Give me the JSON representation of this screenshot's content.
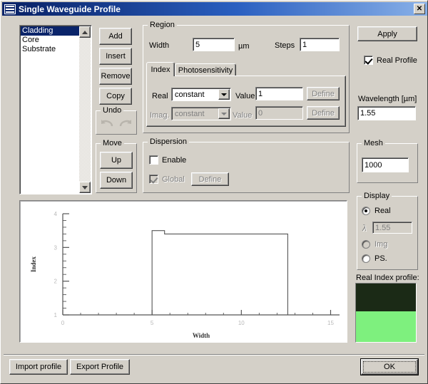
{
  "window": {
    "title": "Single Waveguide Profile",
    "close_label": "✕",
    "icon": "waveguide-icon"
  },
  "layers": {
    "items": [
      {
        "label": "Cladding",
        "selected": true
      },
      {
        "label": "Core",
        "selected": false
      },
      {
        "label": "Substrate",
        "selected": false
      }
    ]
  },
  "layer_buttons": {
    "add": "Add",
    "insert": "Insert",
    "remove": "Remove",
    "copy": "Copy"
  },
  "undo": {
    "title": "Undo",
    "undo_icon": "undo-arrow-icon",
    "redo_icon": "redo-arrow-icon"
  },
  "move": {
    "title": "Move",
    "up": "Up",
    "down": "Down"
  },
  "region": {
    "title": "Region",
    "width_label": "Width",
    "width_value": "5",
    "unit": "µm",
    "steps_label": "Steps",
    "steps_value": "1"
  },
  "tabs": [
    {
      "label": "Index",
      "active": true
    },
    {
      "label": "Photosensitivity",
      "active": false
    }
  ],
  "index_tab": {
    "real_label": "Real",
    "real_mode": "constant",
    "real_value_label": "Value",
    "real_value": "1",
    "real_define": "Define",
    "imag_label": "Imag.",
    "imag_mode": "constant",
    "imag_value_label": "Value",
    "imag_value": "0",
    "imag_define": "Define"
  },
  "dispersion": {
    "title": "Dispersion",
    "enable_label": "Enable",
    "enable_checked": false,
    "global_label": "Global",
    "global_checked": true,
    "define_label": "Define"
  },
  "right_panel": {
    "apply": "Apply",
    "real_profile_label": "Real Profile",
    "real_profile_checked": true,
    "wavelength_label": "Wavelength [µm]",
    "wavelength_value": "1.55",
    "mesh_title": "Mesh",
    "mesh_value": "1000"
  },
  "display": {
    "title": "Display",
    "real_label": "Real",
    "real_selected": true,
    "lambda_symbol": "λ",
    "lambda_value": "1.55",
    "img_label": "Img",
    "img_selected": false,
    "ps_label": "PS.",
    "ps_selected": false
  },
  "index_profile": {
    "caption": "Real Index profile:",
    "top_color": "#1b2a16",
    "bottom_color": "#7ef07e"
  },
  "footer": {
    "import": "Import profile",
    "export": "Export Profile",
    "ok": "OK"
  },
  "chart_data": {
    "type": "line",
    "title": "",
    "xlabel": "Width",
    "ylabel": "Index",
    "xlim": [
      0,
      15.5
    ],
    "ylim": [
      1,
      4
    ],
    "xticks": [
      0,
      5,
      10,
      15
    ],
    "xtick_labels": [
      "0",
      "5",
      "10",
      "15"
    ],
    "yticks": [
      1,
      2,
      3,
      4
    ],
    "ytick_labels": [
      "1",
      "2",
      "3",
      "4"
    ],
    "xminor_step": 1,
    "yminor_step": 0.2,
    "grid": false,
    "legend": null,
    "series": [
      {
        "name": "Real index profile",
        "color": "#555555",
        "x": [
          0,
          5,
          5,
          5.7,
          5.7,
          12.6,
          12.6,
          15.5
        ],
        "y": [
          1,
          1,
          3.5,
          3.5,
          3.4,
          3.4,
          1,
          1
        ]
      }
    ]
  }
}
